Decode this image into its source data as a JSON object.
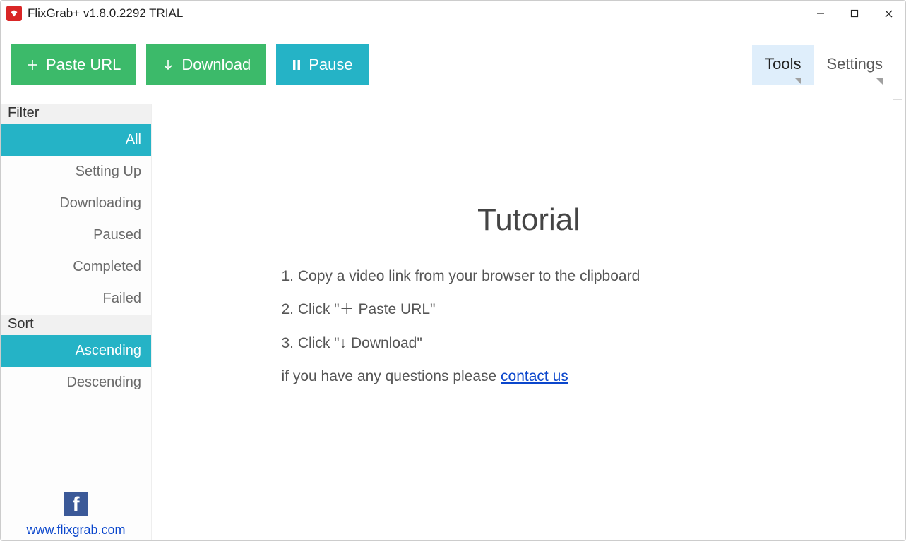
{
  "window": {
    "title": "FlixGrab+ v1.8.0.2292 TRIAL"
  },
  "toolbar": {
    "paste_label": "Paste URL",
    "download_label": "Download",
    "pause_label": "Pause",
    "tools_label": "Tools",
    "settings_label": "Settings"
  },
  "sidebar": {
    "filter_header": "Filter",
    "filter_items": [
      "All",
      "Setting Up",
      "Downloading",
      "Paused",
      "Completed",
      "Failed"
    ],
    "filter_active_index": 0,
    "sort_header": "Sort",
    "sort_items": [
      "Ascending",
      "Descending"
    ],
    "sort_active_index": 0,
    "site_link_text": "www.flixgrab.com"
  },
  "tutorial": {
    "title": "Tutorial",
    "step1": "1. Copy a video link from your browser to the clipboard",
    "step2": "2. Click \"＋ Paste URL\"",
    "step3": "3. Click \"↓ Download\"",
    "question_prefix": "if you have any questions please ",
    "contact_text": "contact us"
  }
}
